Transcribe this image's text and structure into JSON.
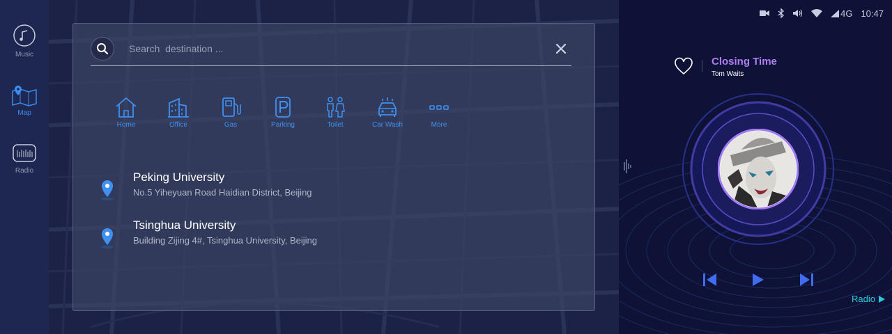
{
  "sidebar": {
    "items": [
      {
        "label": "Music",
        "icon": "music-icon"
      },
      {
        "label": "Map",
        "icon": "map-icon",
        "active": true
      },
      {
        "label": "Radio",
        "icon": "radio-icon"
      }
    ]
  },
  "search": {
    "placeholder": "Search  destination ...",
    "value": ""
  },
  "categories": [
    {
      "label": "Home",
      "icon": "home-icon"
    },
    {
      "label": "Office",
      "icon": "office-icon"
    },
    {
      "label": "Gas",
      "icon": "gas-icon"
    },
    {
      "label": "Parking",
      "icon": "parking-icon"
    },
    {
      "label": "Toilet",
      "icon": "toilet-icon"
    },
    {
      "label": "Car Wash",
      "icon": "car-wash-icon"
    },
    {
      "label": "More",
      "icon": "more-icon"
    }
  ],
  "results": [
    {
      "title": "Peking University",
      "address": "No.5 Yiheyuan Road Haidian District, Beijing"
    },
    {
      "title": "Tsinghua University",
      "address": "Building Zijing 4#, Tsinghua University, Beijing"
    }
  ],
  "status_bar": {
    "network": "4G",
    "time": "10:47"
  },
  "player": {
    "title": "Closing Time",
    "artist": "Tom Waits",
    "radio_label": "Radio"
  },
  "colors": {
    "accent_blue": "#3f90f0",
    "accent_purple": "#b07cf2",
    "accent_cyan": "#2ec8d8",
    "sidebar_bg": "#1d2750",
    "background": "#141a3a"
  }
}
